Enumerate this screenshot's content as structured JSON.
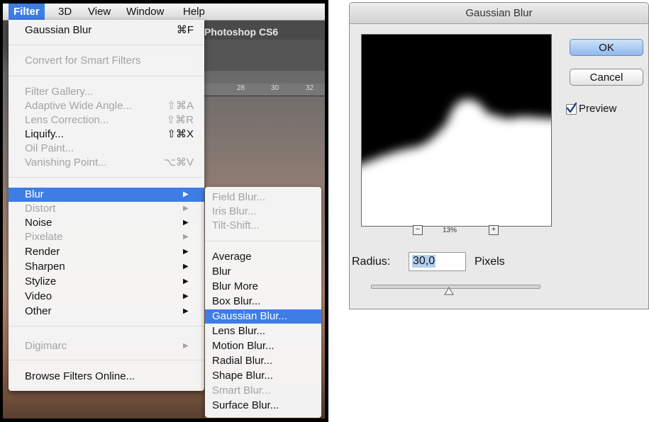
{
  "menubar": {
    "items": [
      "Filter",
      "3D",
      "View",
      "Window",
      "Help"
    ]
  },
  "app": {
    "title_fragment": "Photoshop CS6",
    "ruler_numbers": [
      "28",
      "30",
      "32"
    ]
  },
  "filter_menu": {
    "items": [
      {
        "label": "Gaussian Blur",
        "shortcut": "⌘F"
      },
      {
        "label": "Convert for Smart Filters"
      },
      {
        "label": "Filter Gallery..."
      },
      {
        "label": "Adaptive Wide Angle...",
        "shortcut": "⇧⌘A"
      },
      {
        "label": "Lens Correction...",
        "shortcut": "⇧⌘R"
      },
      {
        "label": "Liquify...",
        "shortcut": "⇧⌘X"
      },
      {
        "label": "Oil Paint..."
      },
      {
        "label": "Vanishing Point...",
        "shortcut": "⌥⌘V"
      },
      {
        "label": "Blur"
      },
      {
        "label": "Distort"
      },
      {
        "label": "Noise"
      },
      {
        "label": "Pixelate"
      },
      {
        "label": "Render"
      },
      {
        "label": "Sharpen"
      },
      {
        "label": "Stylize"
      },
      {
        "label": "Video"
      },
      {
        "label": "Other"
      },
      {
        "label": "Digimarc"
      },
      {
        "label": "Browse Filters Online..."
      }
    ],
    "submenu_arrow": "▶"
  },
  "blur_submenu": {
    "items": [
      "Field Blur...",
      "Iris Blur...",
      "Tilt-Shift...",
      "Average",
      "Blur",
      "Blur More",
      "Box Blur...",
      "Gaussian Blur...",
      "Lens Blur...",
      "Motion Blur...",
      "Radial Blur...",
      "Shape Blur...",
      "Smart Blur...",
      "Surface Blur..."
    ]
  },
  "dialog": {
    "title": "Gaussian Blur",
    "ok_label": "OK",
    "cancel_label": "Cancel",
    "preview_label": "Preview",
    "preview_checked": true,
    "zoom_out": "−",
    "zoom_in": "+",
    "zoom_level": "13%",
    "radius_label": "Radius:",
    "radius_value": "30,0",
    "radius_unit": "Pixels"
  },
  "colors": {
    "selection_blue": "#3d7de4",
    "disabled_text": "#a3a3a3",
    "ok_button": "#a7c8f2"
  }
}
